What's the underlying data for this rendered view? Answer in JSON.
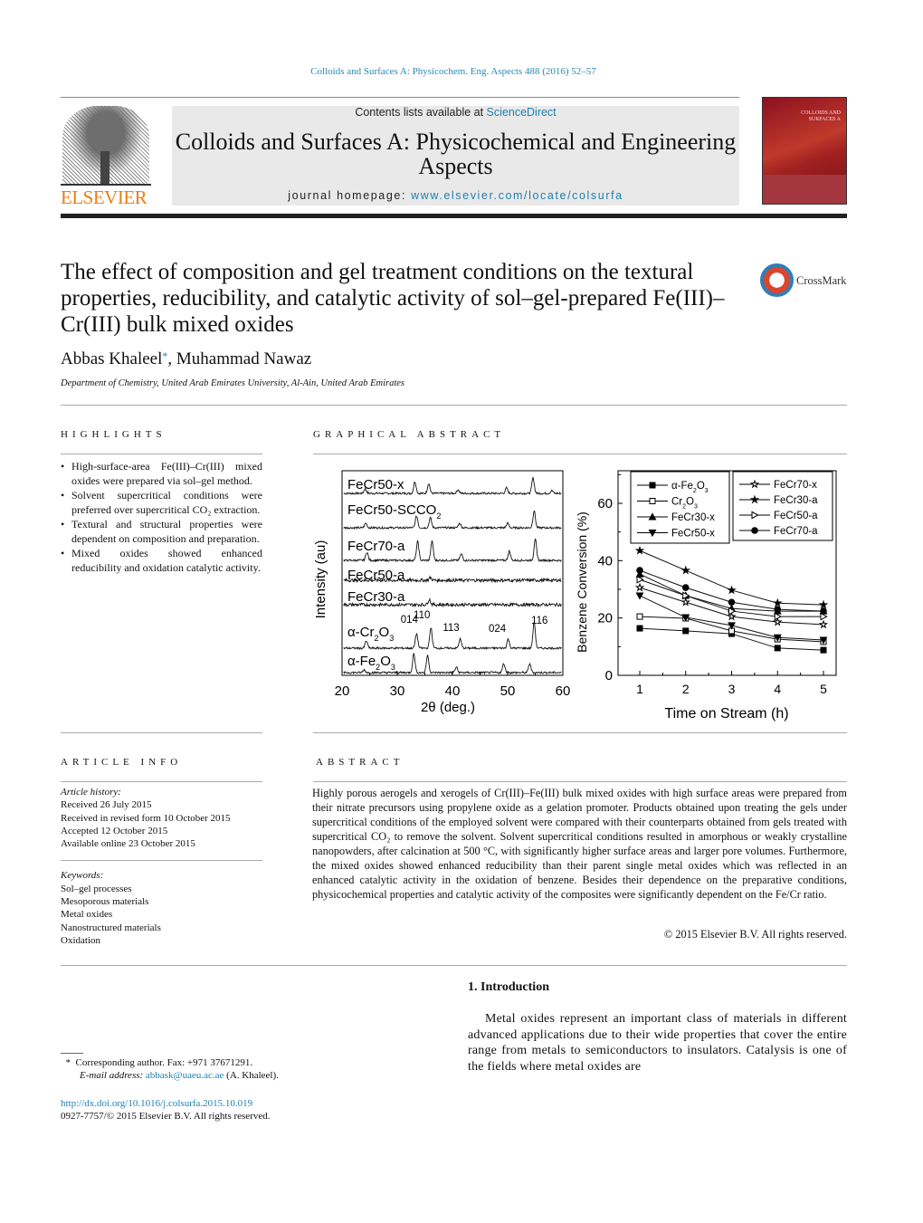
{
  "journal_ref": "Colloids and Surfaces A: Physicochem. Eng. Aspects 488 (2016) 52–57",
  "header": {
    "publisher_logo": "ELSEVIER",
    "contents_prefix": "Contents lists available at ",
    "contents_link": "ScienceDirect",
    "journal_title": "Colloids and Surfaces A: Physicochemical and Engineering Aspects",
    "homepage_prefix": "journal homepage: ",
    "homepage_link": "www.elsevier.com/locate/colsurfa",
    "cover_text": "COLLOIDS AND SURFACES A"
  },
  "article": {
    "title": "The effect of composition and gel treatment conditions on the textural properties, reducibility, and catalytic activity of sol–gel-prepared Fe(III)–Cr(III) bulk mixed oxides",
    "crossmark": "CrossMark",
    "author1": "Abbas Khaleel",
    "author_mark": "*",
    "author2": ", Muhammad Nawaz",
    "affiliation": "Department of Chemistry, United Arab Emirates University, Al-Ain, United Arab Emirates"
  },
  "highlights": {
    "heading": "HIGHLIGHTS",
    "items": [
      "High-surface-area Fe(III)–Cr(III) mixed oxides were prepared via sol–gel method.",
      "Solvent supercritical conditions were preferred over supercritical CO₂ extraction.",
      "Textural and structural properties were dependent on composition and preparation.",
      "Mixed oxides showed enhanced reducibility and oxidation catalytic activity."
    ]
  },
  "graphical_abstract": {
    "heading": "GRAPHICAL ABSTRACT"
  },
  "chart_data": [
    {
      "type": "line",
      "title": "",
      "xlabel": "2θ (deg.)",
      "ylabel": "Intensity (au)",
      "xlim": [
        20,
        60
      ],
      "xticks": [
        "20",
        "30",
        "40",
        "50",
        "60"
      ],
      "series": [
        {
          "name": "FeCr50-x",
          "peaks_2theta": [
            24.2,
            33.2,
            35.7,
            41.0,
            49.8,
            54.6,
            58.0
          ],
          "rel_intensity": [
            5,
            13,
            11,
            4,
            6,
            17,
            3
          ]
        },
        {
          "name": "FeCr50-SCCO2",
          "peaks_2theta": [
            24.3,
            33.5,
            36.0,
            41.3,
            50.0,
            54.8
          ],
          "rel_intensity": [
            5,
            13,
            11,
            5,
            5,
            19
          ]
        },
        {
          "name": "FeCr70-a",
          "peaks_2theta": [
            24.5,
            33.7,
            36.3,
            41.6,
            50.3,
            55.0
          ],
          "rel_intensity": [
            9,
            21,
            21,
            7,
            10,
            24
          ]
        },
        {
          "name": "FeCr50-a",
          "peaks_2theta": [
            36.0
          ],
          "rel_intensity": [
            3
          ]
        },
        {
          "name": "FeCr30-a",
          "peaks_2theta": [
            35.8
          ],
          "rel_intensity": [
            6
          ]
        },
        {
          "name": "α-Cr2O3",
          "peaks_2theta": [
            24.4,
            33.5,
            36.1,
            41.4,
            50.1,
            54.8
          ],
          "rel_intensity": [
            8,
            16,
            23,
            10,
            10,
            29
          ]
        },
        {
          "name": "α-Fe2O3",
          "peaks_2theta": [
            24.0,
            33.0,
            35.5,
            40.7,
            49.3,
            54.0
          ],
          "rel_intensity": [
            3,
            21,
            19,
            6,
            10,
            10
          ]
        }
      ],
      "annotations": [
        {
          "text": "014",
          "x": 33.5
        },
        {
          "text": "110",
          "x": 36.1
        },
        {
          "text": "113",
          "x": 41.4
        },
        {
          "text": "024",
          "x": 50.1
        },
        {
          "text": "116",
          "x": 54.8
        }
      ]
    },
    {
      "type": "line",
      "title": "",
      "xlabel": "Time on Stream (h)",
      "ylabel": "Benzene Conversion (%)",
      "xlim": [
        0.5,
        5.3
      ],
      "ylim": [
        0,
        71
      ],
      "xticks": [
        "1",
        "2",
        "3",
        "4",
        "5"
      ],
      "yticks": [
        "0",
        "20",
        "40",
        "60"
      ],
      "legend": "top",
      "x": [
        1,
        2,
        3,
        4,
        5
      ],
      "series": [
        {
          "name": "α-Fe2O3",
          "marker": "square-filled",
          "values": [
            16.4,
            15.5,
            14.5,
            9.5,
            8.8
          ]
        },
        {
          "name": "Cr2O3",
          "marker": "square-open",
          "values": [
            20.5,
            19.9,
            15.5,
            12.6,
            11.7
          ]
        },
        {
          "name": "FeCr30-x",
          "marker": "triangle-up-filled",
          "values": [
            35.3,
            27.8,
            23.3,
            22.4,
            22.4
          ]
        },
        {
          "name": "FeCr50-x",
          "marker": "triangle-down-filled",
          "values": [
            27.8,
            20.2,
            17.4,
            13.2,
            12.3
          ]
        },
        {
          "name": "FeCr70-x",
          "marker": "star-open",
          "values": [
            30.6,
            25.5,
            20.5,
            18.6,
            17.7
          ]
        },
        {
          "name": "FeCr30-a",
          "marker": "star-filled",
          "values": [
            43.5,
            36.6,
            29.7,
            25.2,
            24.6
          ]
        },
        {
          "name": "FeCr50-a",
          "marker": "triangle-right-open",
          "values": [
            33.4,
            27.8,
            22.4,
            20.5,
            20.5
          ]
        },
        {
          "name": "FeCr70-a",
          "marker": "circle-filled",
          "values": [
            36.6,
            30.6,
            25.5,
            23.0,
            22.4
          ]
        }
      ]
    }
  ],
  "article_info": {
    "heading": "ARTICLE INFO",
    "history_label": "Article history:",
    "history": [
      "Received 26 July 2015",
      "Received in revised form 10 October 2015",
      "Accepted 12 October 2015",
      "Available online 23 October 2015"
    ],
    "keywords_label": "Keywords:",
    "keywords": [
      "Sol–gel processes",
      "Mesoporous materials",
      "Metal oxides",
      "Nanostructured materials",
      "Oxidation"
    ]
  },
  "abstract": {
    "heading": "ABSTRACT",
    "text": "Highly porous aerogels and xerogels of Cr(III)–Fe(III) bulk mixed oxides with high surface areas were prepared from their nitrate precursors using propylene oxide as a gelation promoter. Products obtained upon treating the gels under supercritical conditions of the employed solvent were compared with their counterparts obtained from gels treated with supercritical CO₂ to remove the solvent. Solvent supercritical conditions resulted in amorphous or weakly crystalline nanopowders, after calcination at 500 °C, with significantly higher surface areas and larger pore volumes. Furthermore, the mixed oxides showed enhanced reducibility than their parent single metal oxides which was reflected in an enhanced catalytic activity in the oxidation of benzene. Besides their dependence on the preparative conditions, physicochemical properties and catalytic activity of the composites were significantly dependent on the Fe/Cr ratio.",
    "copyright": "© 2015 Elsevier B.V. All rights reserved."
  },
  "introduction": {
    "heading": "1.  Introduction",
    "text": "Metal oxides represent an important class of materials in different advanced applications due to their wide properties that cover the entire range from metals to semiconductors to insulators. Catalysis is one of the fields where metal oxides are"
  },
  "footnote": {
    "mark": "*",
    "line1": "Corresponding author. Fax: +971 37671291.",
    "email_label": "E-mail address: ",
    "email": "abbask@uaeu.ac.ae",
    "email_suffix": " (A. Khaleel)."
  },
  "doi": {
    "link": "http://dx.doi.org/10.1016/j.colsurfa.2015.10.019",
    "issn": "0927-7757/© 2015 Elsevier B.V. All rights reserved."
  }
}
